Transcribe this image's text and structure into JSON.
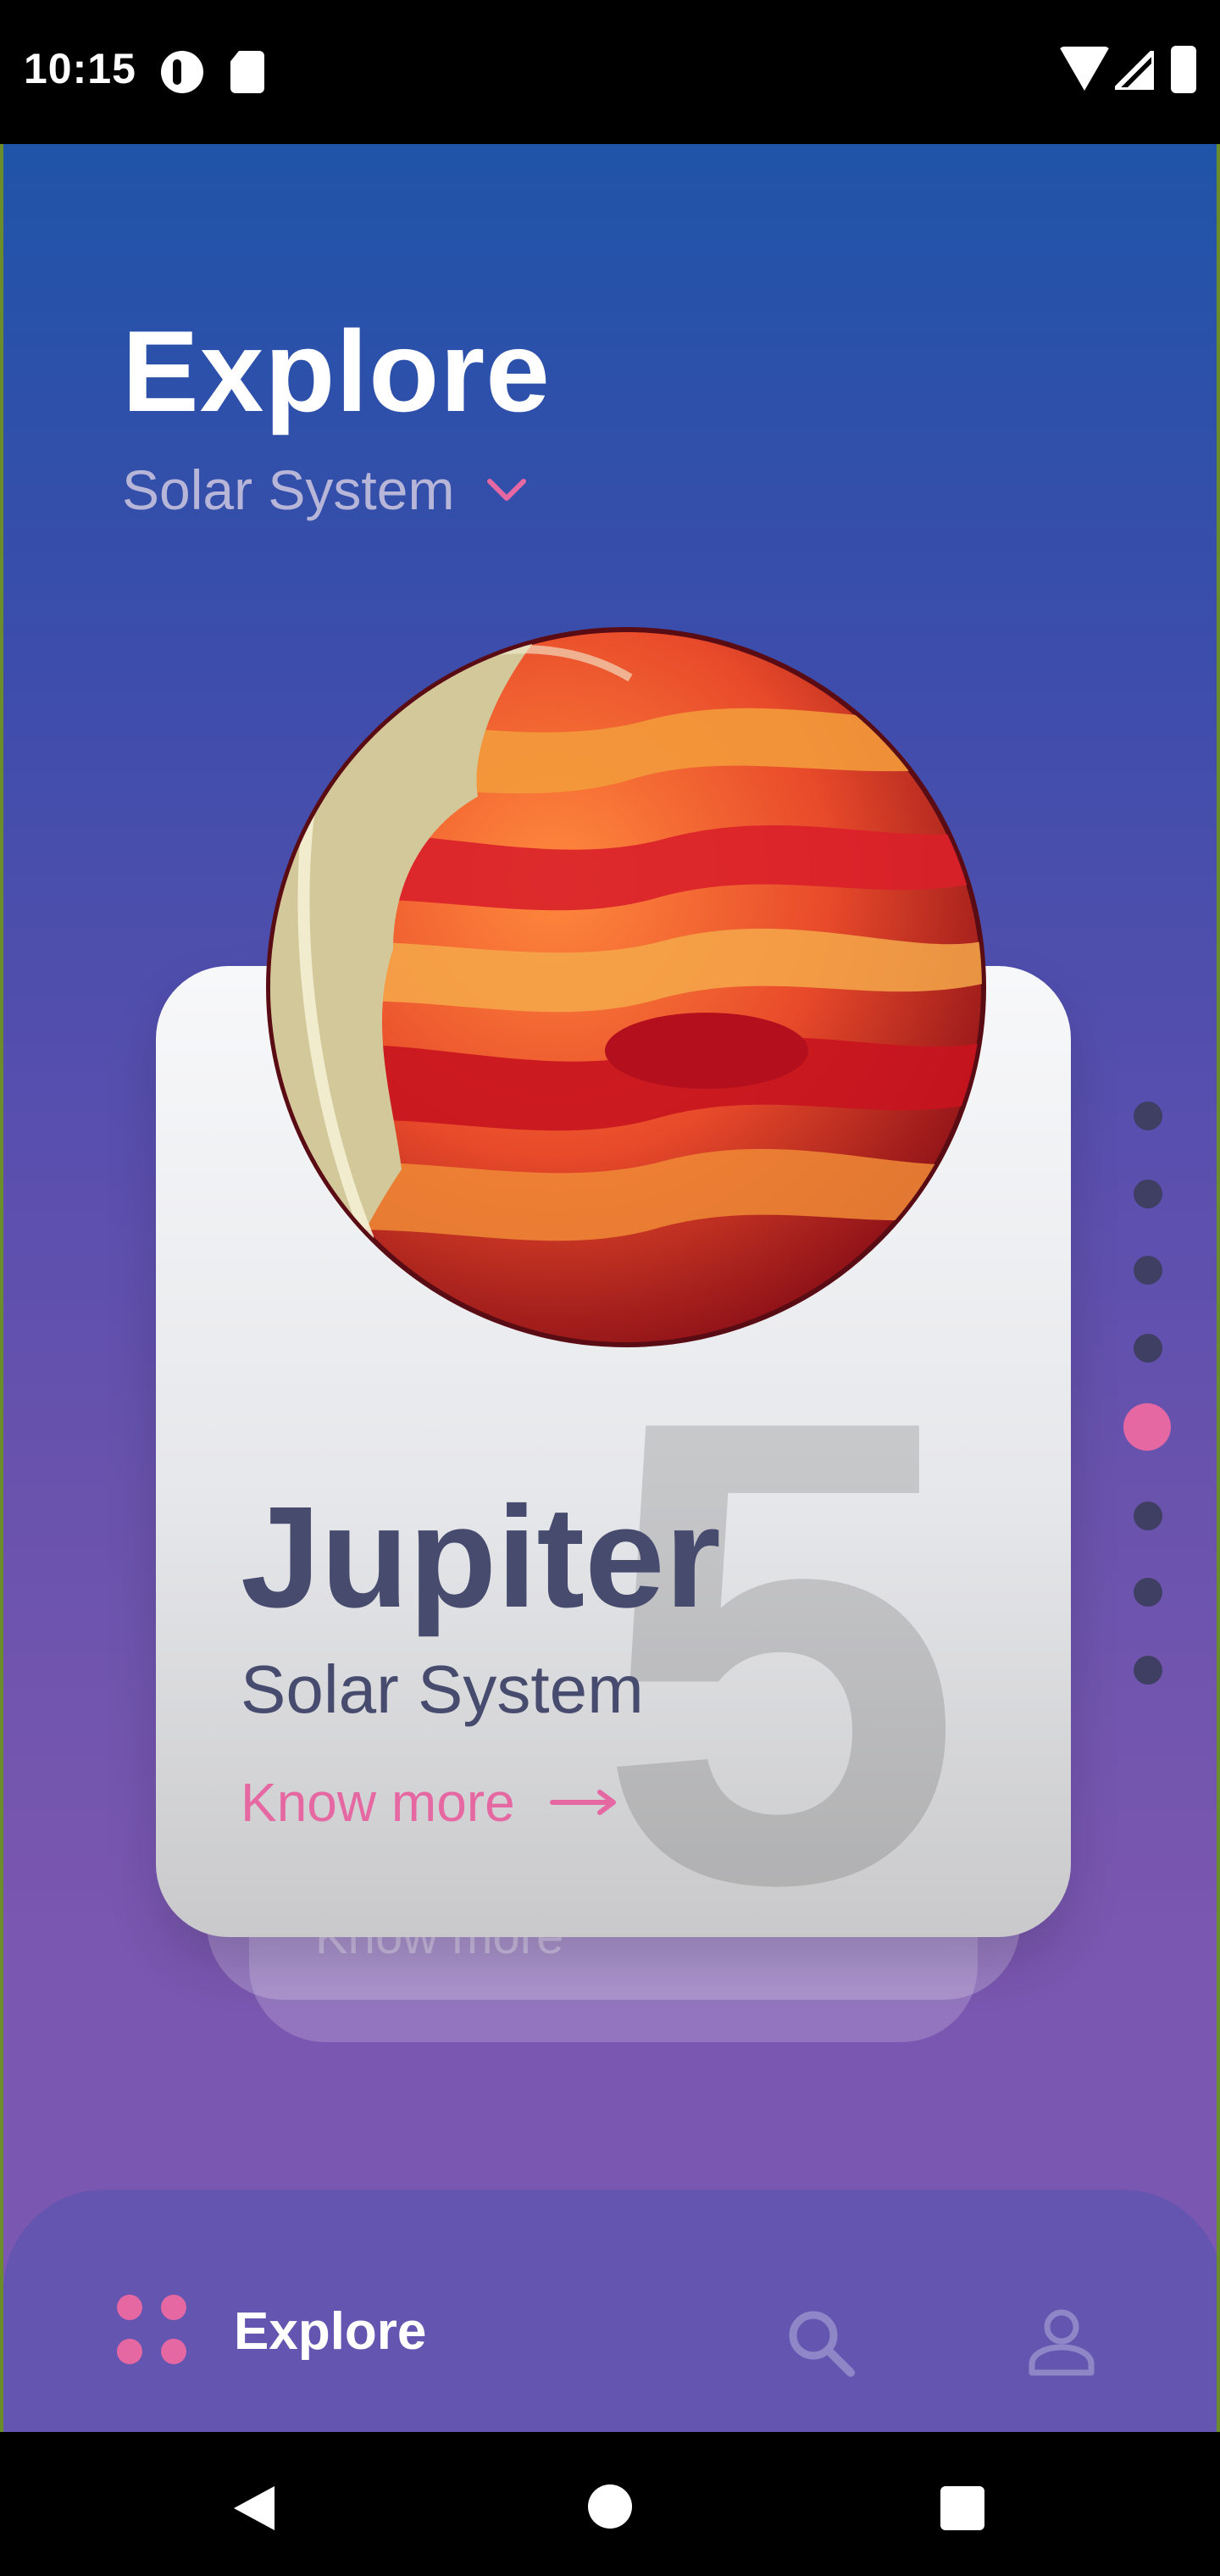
{
  "status_bar": {
    "time": "10:15",
    "icons": [
      "notification-icon",
      "sd-card-icon",
      "wifi-icon",
      "cell-signal-icon",
      "battery-icon"
    ]
  },
  "header": {
    "title": "Explore",
    "subtitle": "Solar System",
    "dropdown_icon": "chevron-down-icon"
  },
  "card": {
    "planet_name": "Jupiter",
    "subtitle": "Solar System",
    "link_label": "Know more",
    "number": "5",
    "ghost_label": "Know more"
  },
  "pager": {
    "total": 8,
    "active_index": 4
  },
  "bottom_nav": {
    "explore_label": "Explore",
    "items": [
      "grid-icon",
      "search-icon",
      "user-icon"
    ]
  },
  "colors": {
    "accent": "#e668a3",
    "text_dark": "#474b6e",
    "nav_bg": "#6355b0"
  }
}
